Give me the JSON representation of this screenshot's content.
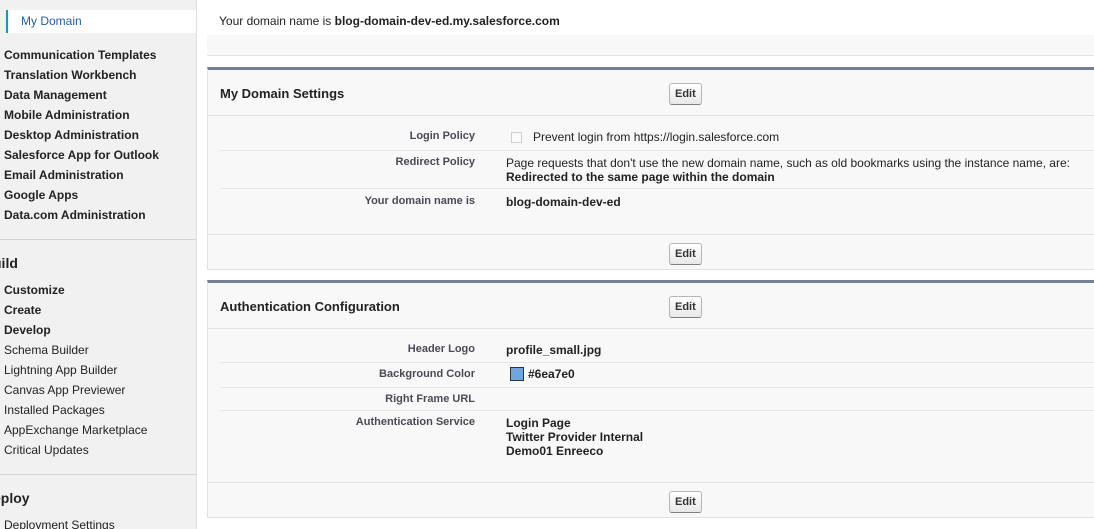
{
  "sidebar": {
    "active_item": "My Domain",
    "admin_items": [
      "Communication Templates",
      "Translation Workbench",
      "Data Management",
      "Mobile Administration",
      "Desktop Administration",
      "Salesforce App for Outlook",
      "Email Administration",
      "Google Apps",
      "Data.com Administration"
    ],
    "build_heading": "uild",
    "build_items": [
      {
        "label": "Customize",
        "bold": true
      },
      {
        "label": "Create",
        "bold": true
      },
      {
        "label": "Develop",
        "bold": true
      },
      {
        "label": "Schema Builder",
        "bold": false
      },
      {
        "label": "Lightning App Builder",
        "bold": false
      },
      {
        "label": "Canvas App Previewer",
        "bold": false
      },
      {
        "label": "Installed Packages",
        "bold": false
      },
      {
        "label": "AppExchange Marketplace",
        "bold": false
      },
      {
        "label": "Critical Updates",
        "bold": false
      }
    ],
    "deploy_heading": "eploy",
    "deploy_items": [
      "Deployment Settings"
    ]
  },
  "domain_banner": {
    "prefix": "Your domain name is ",
    "domain": "blog-domain-dev-ed.my.salesforce.com"
  },
  "settings": {
    "title": "My Domain Settings",
    "edit_label": "Edit",
    "login_policy_label": "Login Policy",
    "login_policy_value": "Prevent login from https://login.salesforce.com",
    "login_policy_checked": false,
    "redirect_policy_label": "Redirect Policy",
    "redirect_policy_text": "Page requests that don't use the new domain name, such as old bookmarks using the instance name, are:",
    "redirect_policy_value": "Redirected to the same page within the domain",
    "domain_name_label": "Your domain name is",
    "domain_name_value": "blog-domain-dev-ed"
  },
  "auth": {
    "title": "Authentication Configuration",
    "edit_label": "Edit",
    "header_logo_label": "Header Logo",
    "header_logo_value": "profile_small.jpg",
    "bg_color_label": "Background Color",
    "bg_color_value": "#6ea7e0",
    "right_frame_label": "Right Frame URL",
    "right_frame_value": "",
    "auth_service_label": "Authentication Service",
    "auth_services": [
      "Login Page",
      "Twitter Provider Internal",
      "Demo01 Enreeco"
    ]
  },
  "colors": {
    "panel_top_bar": "#747e96",
    "sidebar_bg": "#f1f1f1",
    "panel_bg": "#f8f8f8",
    "link": "#1f5fa0"
  }
}
